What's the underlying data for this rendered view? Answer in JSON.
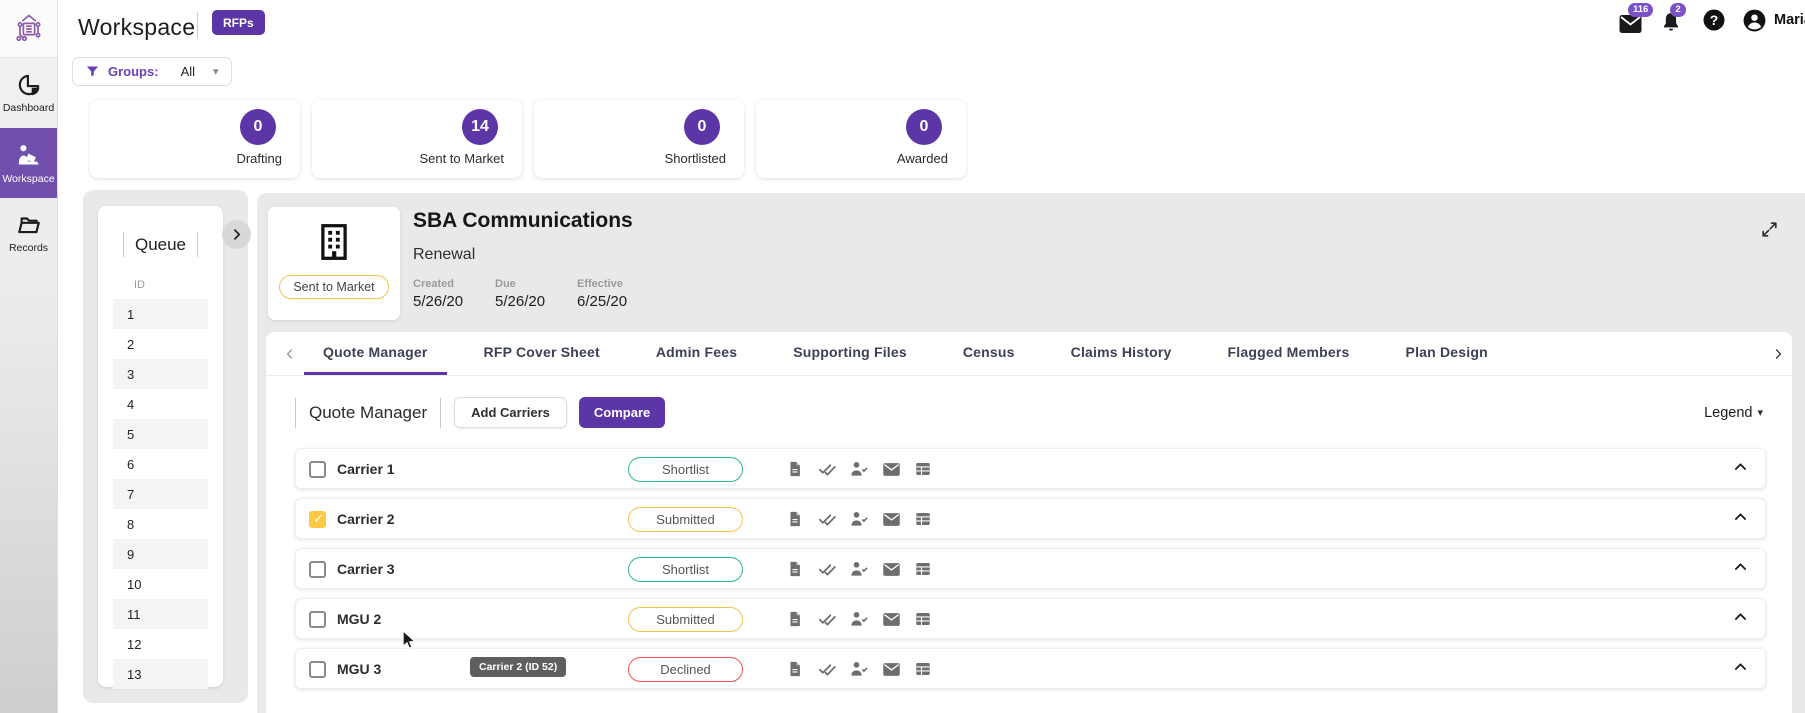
{
  "header": {
    "title": "Workspace",
    "badge": "RFPs",
    "mail_count": "116",
    "notification_count": "2",
    "user_name": "Maria"
  },
  "sidebar": {
    "items": [
      {
        "label": "Dashboard",
        "icon": "pie-chart-icon",
        "active": false
      },
      {
        "label": "Workspace",
        "icon": "person-laptop-icon",
        "active": true
      },
      {
        "label": "Records",
        "icon": "folder-icon",
        "active": false
      }
    ]
  },
  "filters": {
    "groups_label": "Groups:",
    "groups_value": "All"
  },
  "stats": [
    {
      "count": "0",
      "label": "Drafting"
    },
    {
      "count": "14",
      "label": "Sent to Market"
    },
    {
      "count": "0",
      "label": "Shortlisted"
    },
    {
      "count": "0",
      "label": "Awarded"
    }
  ],
  "queue": {
    "title": "Queue",
    "column_header": "ID",
    "ids": [
      "1",
      "2",
      "3",
      "4",
      "5",
      "6",
      "7",
      "8",
      "9",
      "10",
      "11",
      "12",
      "13"
    ]
  },
  "rfp": {
    "company": "SBA Communications",
    "type": "Renewal",
    "status": "Sent to Market",
    "dates": [
      {
        "label": "Created",
        "value": "5/26/20"
      },
      {
        "label": "Due",
        "value": "5/26/20"
      },
      {
        "label": "Effective",
        "value": "6/25/20"
      }
    ]
  },
  "tabs": [
    {
      "label": "Quote Manager",
      "active": true
    },
    {
      "label": "RFP Cover Sheet",
      "active": false
    },
    {
      "label": "Admin Fees",
      "active": false
    },
    {
      "label": "Supporting Files",
      "active": false
    },
    {
      "label": "Census",
      "active": false
    },
    {
      "label": "Claims History",
      "active": false
    },
    {
      "label": "Flagged Members",
      "active": false
    },
    {
      "label": "Plan Design",
      "active": false
    }
  ],
  "quote_manager": {
    "heading": "Quote Manager",
    "add_carriers_label": "Add Carriers",
    "compare_label": "Compare",
    "legend_label": "Legend"
  },
  "carriers": [
    {
      "name": "Carrier 1",
      "status": "Shortlist",
      "status_color": "green",
      "checked": false
    },
    {
      "name": "Carrier 2",
      "status": "Submitted",
      "status_color": "yellow",
      "checked": true
    },
    {
      "name": "Carrier 3",
      "status": "Shortlist",
      "status_color": "green",
      "checked": false
    },
    {
      "name": "MGU 2",
      "status": "Submitted",
      "status_color": "yellow",
      "checked": false
    },
    {
      "name": "MGU 3",
      "status": "Declined",
      "status_color": "red",
      "checked": false
    }
  ],
  "row_icons": [
    "file-icon",
    "double-check-icon",
    "person-check-icon",
    "mail-icon",
    "table-icon"
  ],
  "tooltip": {
    "text": "Carrier 2 (ID 52)"
  },
  "colors": {
    "primary_purple": "#5c35a6",
    "sidebar_active_purple": "#7150ad",
    "notification_badge_purple": "#7b52c7",
    "status_green": "#2eb885",
    "status_yellow": "#f0c64f",
    "status_red": "#ee5253",
    "checked_checkbox_yellow": "#fdc843",
    "panel_gray": "#eae9e9"
  }
}
